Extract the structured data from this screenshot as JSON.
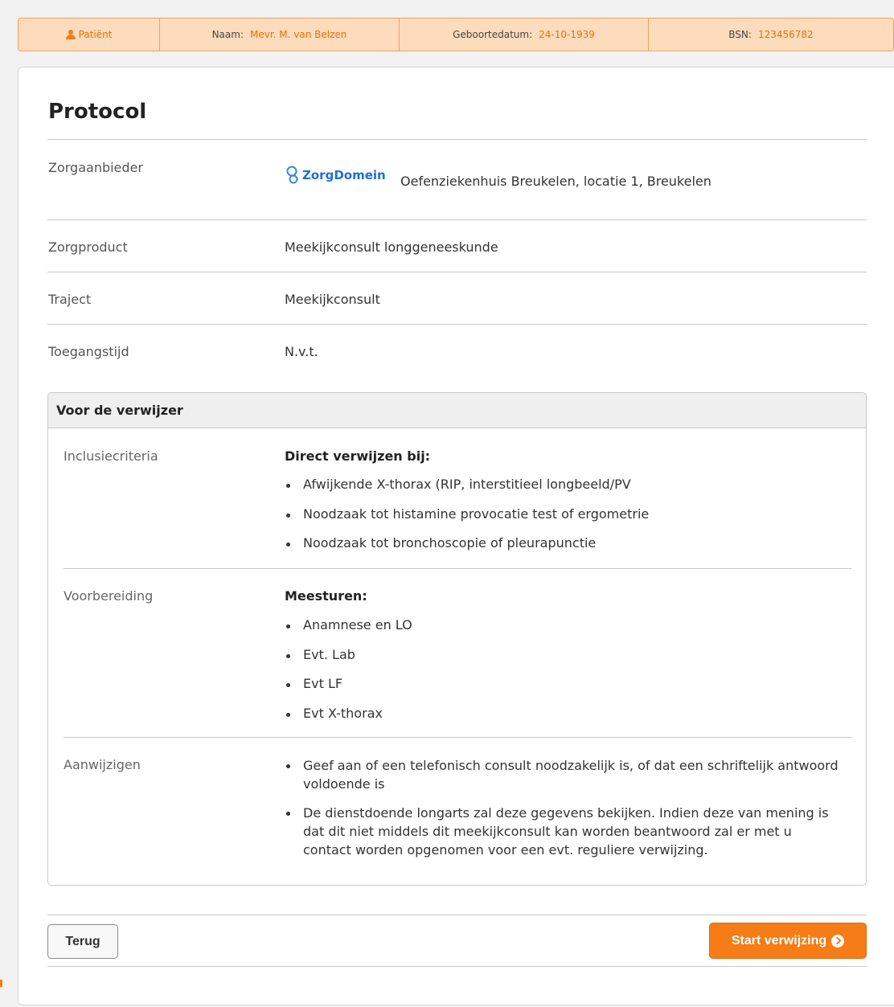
{
  "patient_bar": {
    "patient_label": "Patiënt",
    "name_label": "Naam:",
    "name_value": "Mevr. M. van Belzen",
    "dob_label": "Geboortedatum:",
    "dob_value": "24-10-1939",
    "bsn_label": "BSN:",
    "bsn_value": "123456782"
  },
  "page": {
    "title": "Protocol"
  },
  "rows": {
    "zorgaanbieder": {
      "label": "Zorgaanbieder",
      "logo_text": "ZorgDomein",
      "value": "Oefenziekenhuis Breukelen, locatie 1, Breukelen"
    },
    "zorgproduct": {
      "label": "Zorgproduct",
      "value": "Meekijkconsult longgeneeskunde"
    },
    "traject": {
      "label": "Traject",
      "value": "Meekijkconsult"
    },
    "toegangstijd": {
      "label": "Toegangstijd",
      "value": "N.v.t."
    }
  },
  "panel": {
    "title": "Voor de verwijzer",
    "inclusie": {
      "label": "Inclusiecriteria",
      "heading": "Direct verwijzen bij:",
      "items": [
        "Afwijkende X-thorax (RIP, interstitieel longbeeld/PV",
        "Noodzaak tot histamine provocatie test of ergometrie",
        "Noodzaak tot bronchoscopie of pleurapunctie"
      ]
    },
    "voorbereiding": {
      "label": "Voorbereiding",
      "heading": "Meesturen:",
      "items": [
        "Anamnese en LO",
        "Evt. Lab",
        "Evt LF",
        "Evt X-thorax"
      ]
    },
    "aanwijzigen": {
      "label": "Aanwijzigen",
      "items": [
        "Geef aan of een telefonisch consult noodzakelijk is, of dat een schriftelijk antwoord voldoende is",
        "De dienstdoende longarts zal deze gegevens bekijken. Indien deze van mening is dat dit niet middels dit meekijkconsult kan worden beantwoord zal er met u contact worden opgenomen voor een evt. reguliere verwijzing."
      ]
    }
  },
  "actions": {
    "back_label": "Terug",
    "start_label": "Start verwijzing"
  },
  "colors": {
    "accent": "#f57c16",
    "patient_bar_bg": "#fddcbd",
    "logo_blue": "#1f6fd1"
  }
}
